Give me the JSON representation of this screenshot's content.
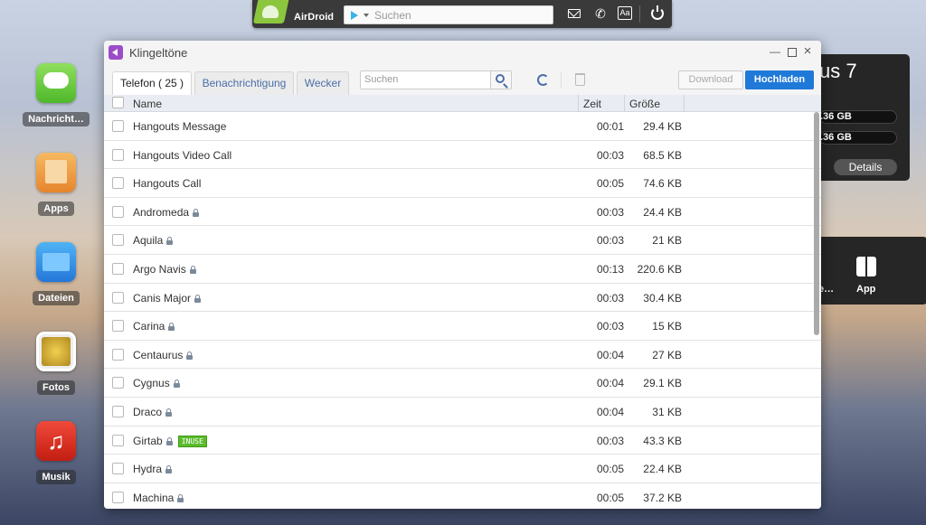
{
  "topbar": {
    "logo_text": "AirDroid",
    "search_placeholder": "Suchen",
    "icons": [
      "message-add-icon",
      "phone-icon",
      "font-icon",
      "power-icon"
    ]
  },
  "desktop": {
    "items": [
      {
        "label": "Nachricht…",
        "icon": "messages-icon"
      },
      {
        "label": "Apps",
        "icon": "apps-icon"
      },
      {
        "label": "Dateien",
        "icon": "folder-icon"
      },
      {
        "label": "Fotos",
        "icon": "photos-icon"
      },
      {
        "label": "Musik",
        "icon": "music-icon"
      }
    ]
  },
  "device_panel": {
    "title_fragment": "us 7",
    "storage": [
      ".36 GB",
      ".36 GB"
    ],
    "details_label": "Details"
  },
  "tools_panel": {
    "left_label": "e…",
    "app_label": "App"
  },
  "window": {
    "title": "Klingeltöne",
    "tabs": [
      {
        "label": "Telefon ( 25 )",
        "active": true
      },
      {
        "label": "Benachrichtigung",
        "active": false
      },
      {
        "label": "Wecker",
        "active": false
      }
    ],
    "search_placeholder": "Suchen",
    "download_label": "Download",
    "upload_label": "Hochladen",
    "columns": {
      "name": "Name",
      "time": "Zeit",
      "size": "Größe"
    },
    "rows": [
      {
        "name": "Hangouts Message",
        "locked": false,
        "inuse": false,
        "time": "00:01",
        "size": "29.4 KB"
      },
      {
        "name": "Hangouts Video Call",
        "locked": false,
        "inuse": false,
        "time": "00:03",
        "size": "68.5 KB"
      },
      {
        "name": "Hangouts Call",
        "locked": false,
        "inuse": false,
        "time": "00:05",
        "size": "74.6 KB"
      },
      {
        "name": "Andromeda",
        "locked": true,
        "inuse": false,
        "time": "00:03",
        "size": "24.4 KB"
      },
      {
        "name": "Aquila",
        "locked": true,
        "inuse": false,
        "time": "00:03",
        "size": "21 KB"
      },
      {
        "name": "Argo Navis",
        "locked": true,
        "inuse": false,
        "time": "00:13",
        "size": "220.6 KB"
      },
      {
        "name": "Canis Major",
        "locked": true,
        "inuse": false,
        "time": "00:03",
        "size": "30.4 KB"
      },
      {
        "name": "Carina",
        "locked": true,
        "inuse": false,
        "time": "00:03",
        "size": "15 KB"
      },
      {
        "name": "Centaurus",
        "locked": true,
        "inuse": false,
        "time": "00:04",
        "size": "27 KB"
      },
      {
        "name": "Cygnus",
        "locked": true,
        "inuse": false,
        "time": "00:04",
        "size": "29.1 KB"
      },
      {
        "name": "Draco",
        "locked": true,
        "inuse": false,
        "time": "00:04",
        "size": "31 KB"
      },
      {
        "name": "Girtab",
        "locked": true,
        "inuse": true,
        "inuse_label": "INUSE",
        "time": "00:03",
        "size": "43.3 KB"
      },
      {
        "name": "Hydra",
        "locked": true,
        "inuse": false,
        "time": "00:05",
        "size": "22.4 KB"
      },
      {
        "name": "Machina",
        "locked": true,
        "inuse": false,
        "time": "00:05",
        "size": "37.2 KB"
      }
    ]
  },
  "colors": {
    "accent": "#1f79d8",
    "tab_link": "#4a6ea8",
    "inuse_badge": "#5bbb2d"
  }
}
